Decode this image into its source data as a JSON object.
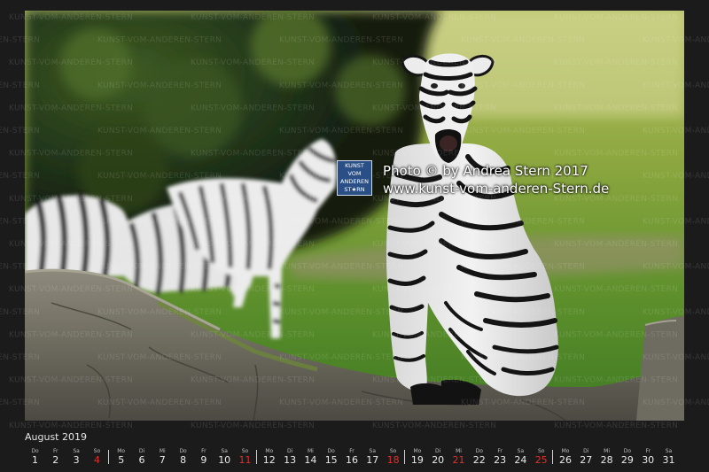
{
  "logo": {
    "lines": [
      "KUNST",
      "VOM",
      "ANDEREN",
      "ST★RN"
    ]
  },
  "credit": {
    "line1": "Photo © by Andrea Stern 2017",
    "line2": "www.kunst-vom-anderen-Stern.de"
  },
  "watermark": {
    "text": "KUNST-VOM-ANDEREN-STERN"
  },
  "calendar": {
    "month": "August 2019",
    "days": [
      {
        "d": "1",
        "w": "Do"
      },
      {
        "d": "2",
        "w": "Fr"
      },
      {
        "d": "3",
        "w": "Sa"
      },
      {
        "d": "4",
        "w": "So",
        "red": true
      },
      {
        "d": "5",
        "w": "Mo"
      },
      {
        "d": "6",
        "w": "Di"
      },
      {
        "d": "7",
        "w": "Mi"
      },
      {
        "d": "8",
        "w": "Do"
      },
      {
        "d": "9",
        "w": "Fr"
      },
      {
        "d": "10",
        "w": "Sa"
      },
      {
        "d": "11",
        "w": "So",
        "red": true
      },
      {
        "d": "12",
        "w": "Mo"
      },
      {
        "d": "13",
        "w": "Di"
      },
      {
        "d": "14",
        "w": "Mi"
      },
      {
        "d": "15",
        "w": "Do"
      },
      {
        "d": "16",
        "w": "Fr"
      },
      {
        "d": "17",
        "w": "Sa"
      },
      {
        "d": "18",
        "w": "So",
        "red": true
      },
      {
        "d": "19",
        "w": "Mo"
      },
      {
        "d": "20",
        "w": "Di"
      },
      {
        "d": "21",
        "w": "Mi",
        "red": true
      },
      {
        "d": "22",
        "w": "Do"
      },
      {
        "d": "23",
        "w": "Fr"
      },
      {
        "d": "24",
        "w": "Sa"
      },
      {
        "d": "25",
        "w": "So",
        "red": true
      },
      {
        "d": "26",
        "w": "Mo"
      },
      {
        "d": "27",
        "w": "Di"
      },
      {
        "d": "28",
        "w": "Mi"
      },
      {
        "d": "29",
        "w": "Do"
      },
      {
        "d": "30",
        "w": "Fr"
      },
      {
        "d": "31",
        "w": "Sa"
      }
    ]
  }
}
